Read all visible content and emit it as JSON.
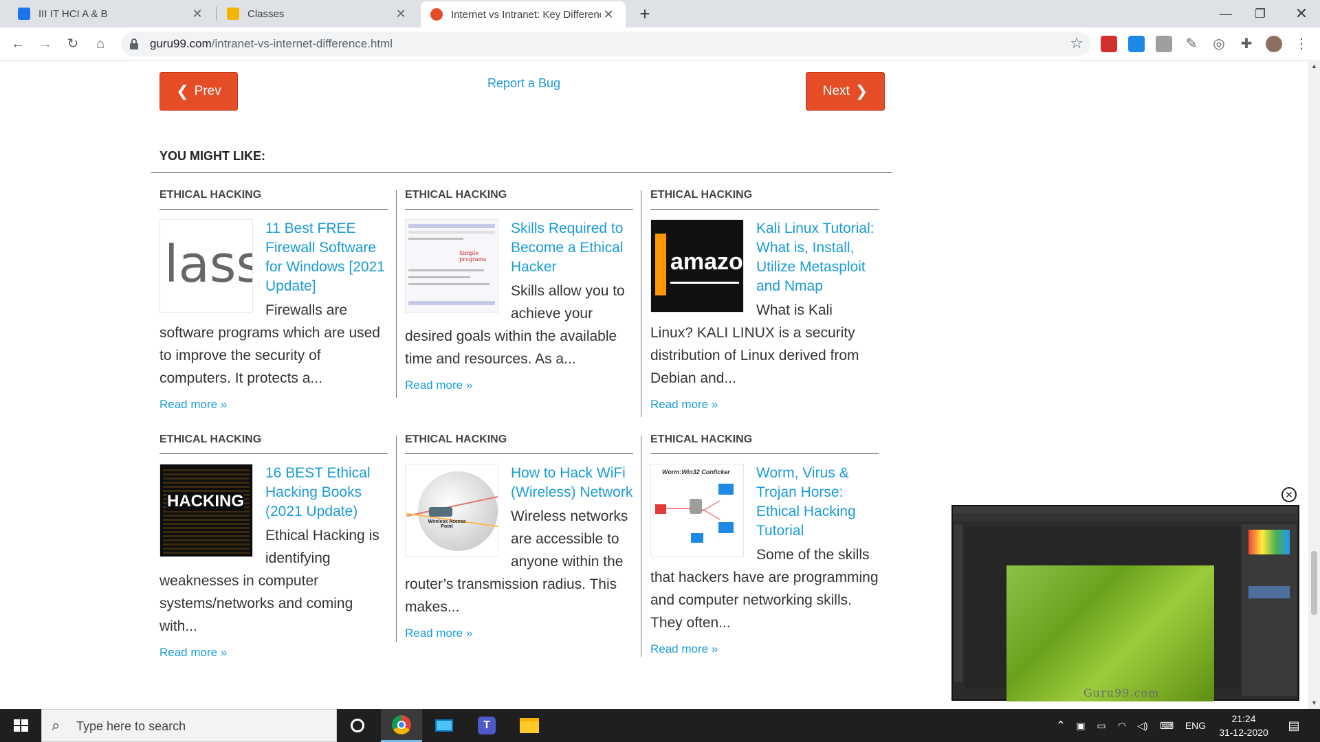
{
  "browser": {
    "tabs": [
      {
        "title": "III IT HCI A & B",
        "favicon_color": "#1a73e8",
        "active": false
      },
      {
        "title": "Classes",
        "favicon_color": "#f4b400",
        "active": false
      },
      {
        "title": "Internet vs Intranet: Key Differenc",
        "favicon_color": "#e44d26",
        "active": true
      }
    ],
    "url_host": "guru99.com",
    "url_path": "/intranet-vs-internet-difference.html",
    "icons": [
      "back-icon",
      "forward-icon",
      "reload-icon",
      "home-icon",
      "lock-icon",
      "star-icon",
      "acrobat-icon",
      "screen-capture-icon",
      "camera-icon",
      "eyedropper-icon",
      "extension-circle-icon",
      "puzzle-icon",
      "avatar",
      "menu-icon"
    ]
  },
  "nav": {
    "prev_label": "Prev",
    "next_label": "Next",
    "report_label": "Report a Bug"
  },
  "section_title": "YOU MIGHT LIKE:",
  "cards": [
    {
      "category": "ETHICAL HACKING",
      "title": "11 Best FREE Firewall Software for Windows [2021 Update]",
      "description": "Firewalls are software programs which are used to improve the security of computers. It protects a...",
      "more": "Read more »",
      "thumb_text": "lass"
    },
    {
      "category": "ETHICAL HACKING",
      "title": "Skills Required to Become a Ethical Hacker",
      "description": "Skills allow you to achieve your desired goals within the available time and resources. As a...",
      "more": "Read more »",
      "thumb_text": "Simple programs"
    },
    {
      "category": "ETHICAL HACKING",
      "title": "Kali Linux Tutorial: What is, Install, Utilize Metasploit and Nmap",
      "description": "What is Kali Linux? KALI LINUX is a security distribution of Linux derived from Debian and...",
      "more": "Read more »",
      "thumb_text": "amazo"
    },
    {
      "category": "ETHICAL HACKING",
      "title": "16 BEST Ethical Hacking Books (2021 Update)",
      "description": "Ethical Hacking is identifying weaknesses in computer systems/networks and coming with...",
      "more": "Read more »",
      "thumb_text": "HACKING"
    },
    {
      "category": "ETHICAL HACKING",
      "title": "How to Hack WiFi (Wireless) Network",
      "description": "Wireless networks are accessible to anyone within the router’s transmission radius. This makes...",
      "more": "Read more »",
      "thumb_text": "Wireless Access Point"
    },
    {
      "category": "ETHICAL HACKING",
      "title": "Worm, Virus & Trojan Horse: Ethical Hacking Tutorial",
      "description": "Some of the skills that hackers have are programming and computer networking skills. They often...",
      "more": "Read more »",
      "thumb_text": "Worm:Win32 Conficker"
    }
  ],
  "video": {
    "watermark": "Guru99.com"
  },
  "taskbar": {
    "search_placeholder": "Type here to search",
    "language": "ENG",
    "time": "21:24",
    "date": "31-12-2020"
  },
  "colors": {
    "accent_red": "#e44d26",
    "link_blue": "#1a9bd7"
  }
}
